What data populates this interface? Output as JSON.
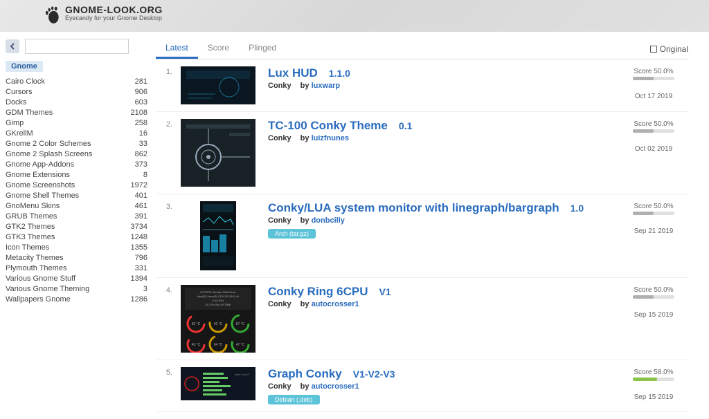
{
  "header": {
    "logo_main": "GNOME-LOOK.ORG",
    "logo_sub": "Eyecandy for your Gnome Desktop"
  },
  "search": {
    "placeholder": ""
  },
  "active_category": "Gnome",
  "categories": [
    {
      "name": "Cairo Clock",
      "count": "281"
    },
    {
      "name": "Cursors",
      "count": "906"
    },
    {
      "name": "Docks",
      "count": "603"
    },
    {
      "name": "GDM Themes",
      "count": "2108"
    },
    {
      "name": "Gimp",
      "count": "258"
    },
    {
      "name": "GKrellM",
      "count": "16"
    },
    {
      "name": "Gnome 2 Color Schemes",
      "count": "33"
    },
    {
      "name": "Gnome 2 Splash Screens",
      "count": "862"
    },
    {
      "name": "Gnome App-Addons",
      "count": "373"
    },
    {
      "name": "Gnome Extensions",
      "count": "8"
    },
    {
      "name": "Gnome Screenshots",
      "count": "1972"
    },
    {
      "name": "Gnome Shell Themes",
      "count": "401"
    },
    {
      "name": "GnoMenu Skins",
      "count": "461"
    },
    {
      "name": "GRUB Themes",
      "count": "391"
    },
    {
      "name": "GTK2 Themes",
      "count": "3734"
    },
    {
      "name": "GTK3 Themes",
      "count": "1248"
    },
    {
      "name": "Icon Themes",
      "count": "1355"
    },
    {
      "name": "Metacity Themes",
      "count": "796"
    },
    {
      "name": "Plymouth Themes",
      "count": "331"
    },
    {
      "name": "Various Gnome Stuff",
      "count": "1394"
    },
    {
      "name": "Various Gnome Theming",
      "count": "3"
    },
    {
      "name": "Wallpapers Gnome",
      "count": "1286"
    }
  ],
  "tabs": {
    "latest": "Latest",
    "score": "Score",
    "plinged": "Plinged"
  },
  "original_label": "Original",
  "items": [
    {
      "num": "1.",
      "title": "Lux HUD",
      "version": "1.1.0",
      "category": "Conky",
      "by_label": "by",
      "author": "luxwarp",
      "score_label": "Score 50.0%",
      "score_pct": 50,
      "date": "Oct 17 2019",
      "badge": ""
    },
    {
      "num": "2.",
      "title": "TC-100 Conky Theme",
      "version": "0.1",
      "category": "Conky",
      "by_label": "by",
      "author": "luizfnunes",
      "score_label": "Score 50.0%",
      "score_pct": 50,
      "date": "Oct 02 2019",
      "badge": ""
    },
    {
      "num": "3.",
      "title": "Conky/LUA system monitor with linegraph/bargraph",
      "version": "1.0",
      "category": "Conky",
      "by_label": "by",
      "author": "donbcilly",
      "score_label": "Score 50.0%",
      "score_pct": 50,
      "date": "Sep 21 2019",
      "badge": "Arch (tar.gz)"
    },
    {
      "num": "4.",
      "title": "Conky Ring 6CPU",
      "version": "V1",
      "category": "Conky",
      "by_label": "by",
      "author": "autocrosser1",
      "score_label": "Score 50.0%",
      "score_pct": 50,
      "date": "Sep 15 2019",
      "badge": ""
    },
    {
      "num": "5.",
      "title": "Graph Conky",
      "version": "V1-V2-V3",
      "category": "Conky",
      "by_label": "by",
      "author": "autocrosser1",
      "score_label": "Score 58.0%",
      "score_pct": 58,
      "date": "Sep 15 2019",
      "badge": "Debian (.deb)"
    }
  ]
}
